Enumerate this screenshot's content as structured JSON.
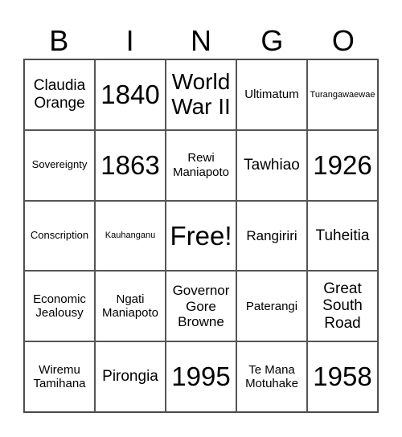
{
  "header": [
    "B",
    "I",
    "N",
    "G",
    "O"
  ],
  "cells": [
    [
      "Claudia Orange",
      "1840",
      "World War II",
      "Ultimatum",
      "Turangawaewae"
    ],
    [
      "Sovereignty",
      "1863",
      "Rewi Maniapoto",
      "Tawhiao",
      "1926"
    ],
    [
      "Conscription",
      "Kauhanganu",
      "Free!",
      "Rangiriri",
      "Tuheitia"
    ],
    [
      "Economic Jealousy",
      "Ngati Maniapoto",
      "Governor Gore Browne",
      "Paterangi",
      "Great South Road"
    ],
    [
      "Wiremu Tamihana",
      "Pirongia",
      "1995",
      "Te Mana Motuhake",
      "1958"
    ]
  ]
}
